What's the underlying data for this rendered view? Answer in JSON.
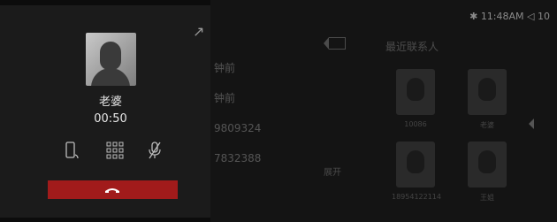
{
  "status_bar": {
    "time": "11:48AM",
    "extra": "10"
  },
  "dialer": {
    "recent_lines": [
      "钟前",
      "钟前",
      "9809324",
      "7832388"
    ],
    "expand_label": "展开",
    "recent_contacts_title": "最近联系人",
    "contacts": [
      {
        "label": "10086"
      },
      {
        "label": "老婆"
      },
      {
        "label": "18954122114"
      },
      {
        "label": "王姐"
      }
    ]
  },
  "call": {
    "contact_name": "老婆",
    "duration": "00:50",
    "controls": [
      "phone-device-icon",
      "dialpad-icon",
      "mute-mic-icon"
    ],
    "end_call_color": "#a11b1b"
  }
}
